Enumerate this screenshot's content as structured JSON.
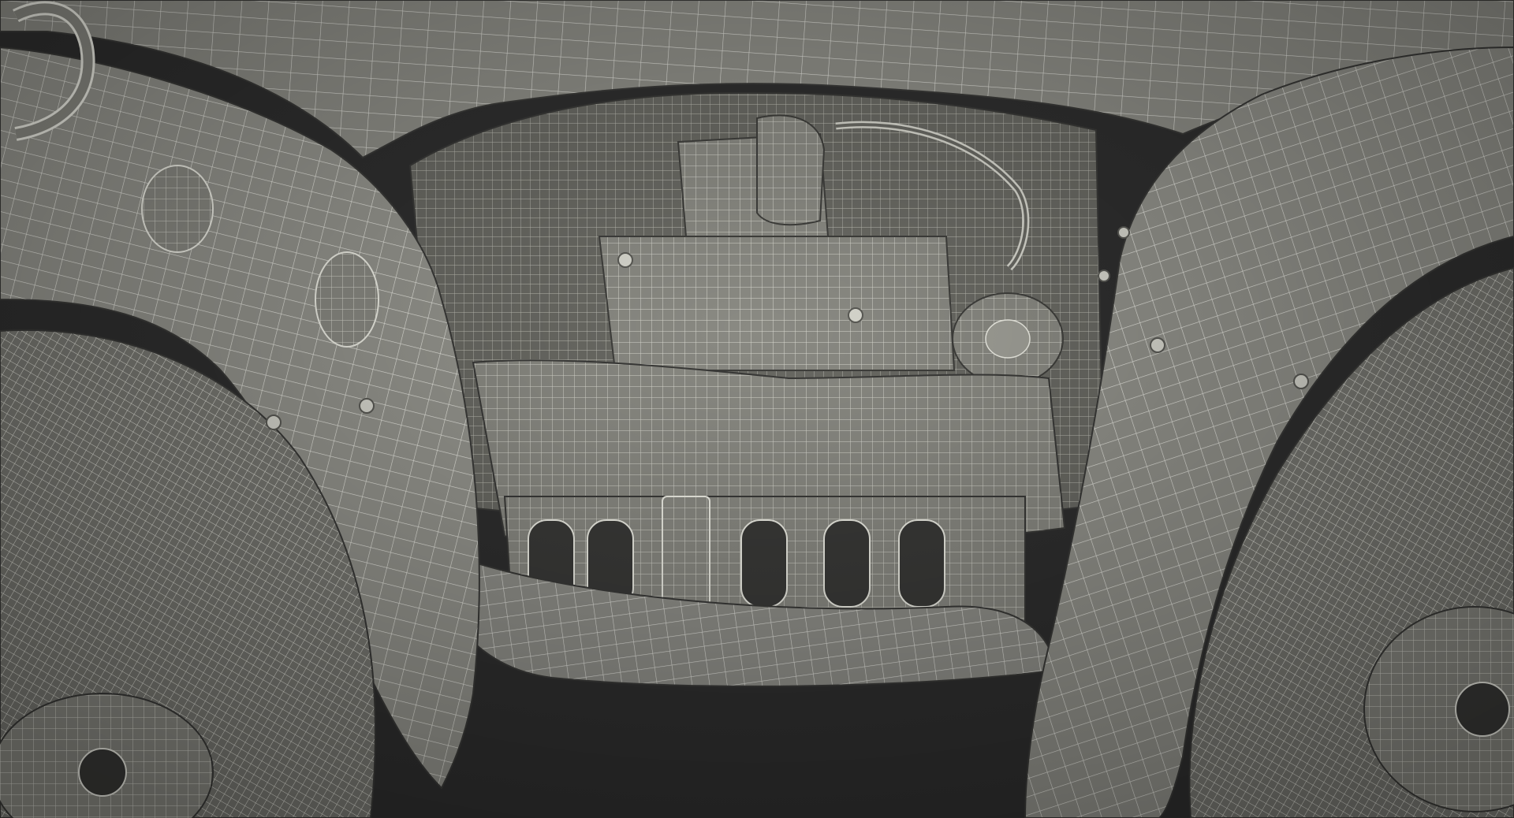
{
  "scene": {
    "subject": "ATV",
    "render_style": "wireframe",
    "colors": {
      "background": "#2f2f2f",
      "surface": "#8a8a83",
      "surface_dark": "#6b6b64",
      "surface_light": "#a4a49c",
      "wire": "#f2f2ea",
      "tire": "#7c7c76",
      "shadow": "#3a3a38"
    }
  }
}
